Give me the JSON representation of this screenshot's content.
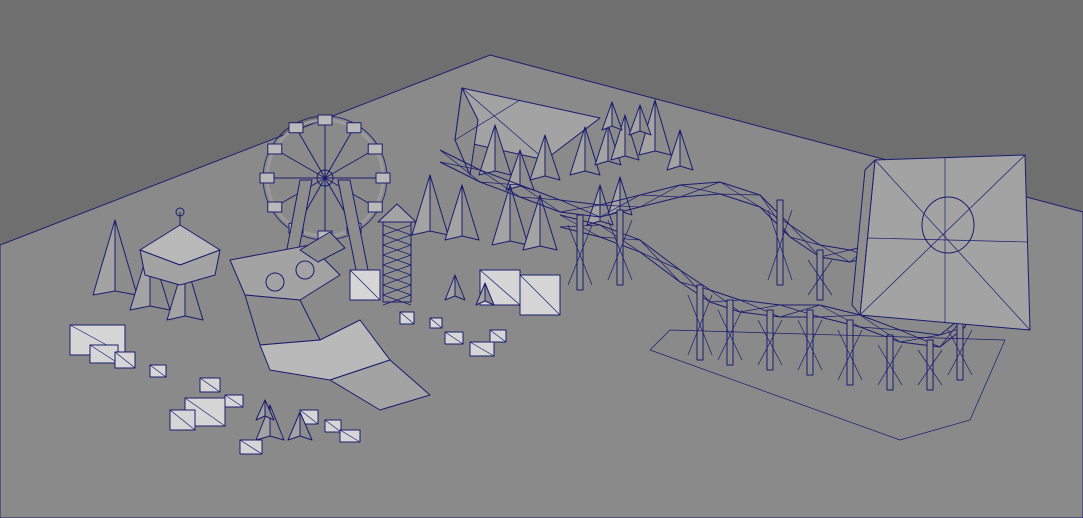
{
  "viewport": {
    "background_color": "#6e6e6e",
    "floor_color": "#8a8a8a",
    "wireframe_color": "#1a1d6e",
    "display_mode": "wireframe-on-shaded"
  },
  "scene_objects": [
    {
      "name": "ground-plane"
    },
    {
      "name": "ferris-wheel"
    },
    {
      "name": "roller-coaster"
    },
    {
      "name": "coaster-loop-wall"
    },
    {
      "name": "carousel"
    },
    {
      "name": "pine-trees"
    },
    {
      "name": "crates"
    },
    {
      "name": "ride-vehicle"
    },
    {
      "name": "tower"
    }
  ]
}
